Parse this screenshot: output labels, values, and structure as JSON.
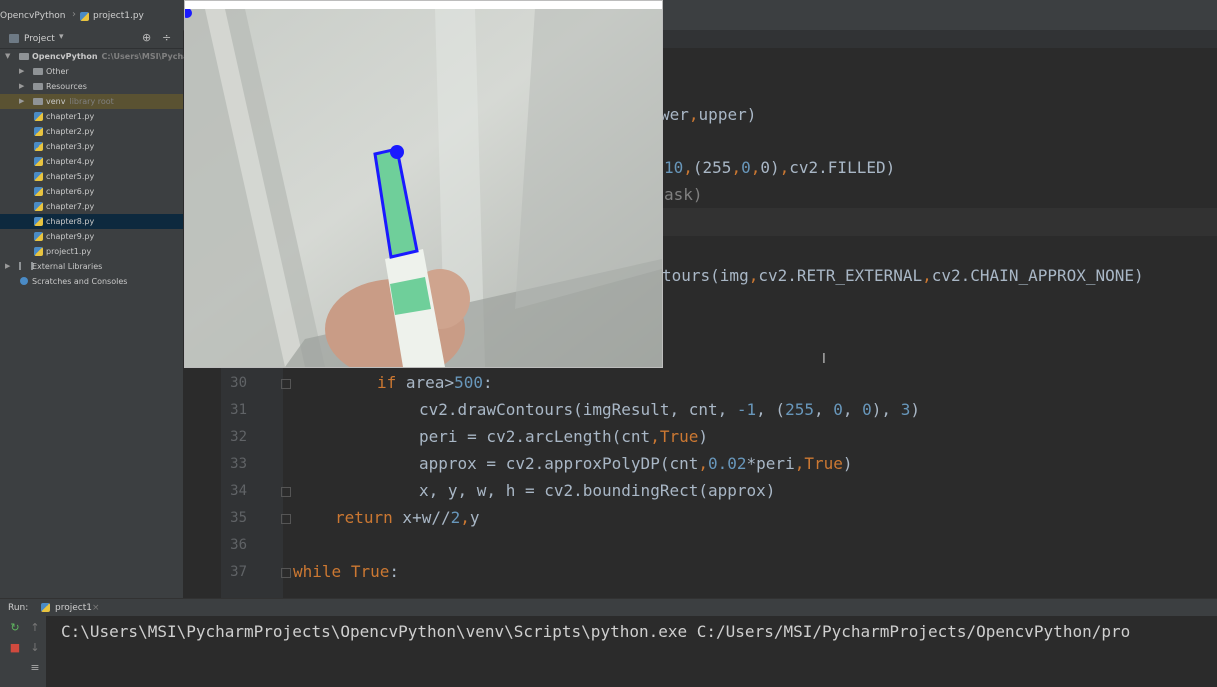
{
  "breadcrumb": {
    "project": "OpencvPython",
    "file": "project1.py"
  },
  "project_panel": {
    "title": "Project",
    "root": {
      "name": "OpencvPython",
      "path": "C:\\Users\\MSI\\Pycharm"
    },
    "items": [
      {
        "label": "Other"
      },
      {
        "label": "Resources"
      },
      {
        "label": "venv",
        "hint": "library root"
      },
      {
        "label": "chapter1.py"
      },
      {
        "label": "chapter2.py"
      },
      {
        "label": "chapter3.py"
      },
      {
        "label": "chapter4.py"
      },
      {
        "label": "chapter5.py"
      },
      {
        "label": "chapter6.py"
      },
      {
        "label": "chapter7.py"
      },
      {
        "label": "chapter8.py"
      },
      {
        "label": "chapter9.py"
      },
      {
        "label": "project1.py"
      },
      {
        "label": "External Libraries"
      },
      {
        "label": "Scratches and Consoles"
      }
    ]
  },
  "editor": {
    "partial": [
      "wer",
      "upper)",
      "10",
      "(255",
      "0",
      "0)",
      "cv2.FILLED)",
      "ask)",
      "tours(img",
      "cv2.RETR_EXTERNAL",
      "cv2.CHAIN_APPROX_NONE)"
    ],
    "lines": [
      {
        "n": "30",
        "parts": [
          [
            "if",
            "kw"
          ],
          [
            " area",
            ""
          ],
          [
            ">",
            ""
          ],
          [
            "500",
            "num"
          ],
          [
            ":",
            ""
          ]
        ]
      },
      {
        "n": "31",
        "parts": [
          [
            "cv2.drawContours(imgResult, cnt, ",
            ""
          ],
          [
            "-1",
            "num"
          ],
          [
            ", (",
            ""
          ],
          [
            "255",
            "num"
          ],
          [
            ", ",
            ""
          ],
          [
            "0",
            "num"
          ],
          [
            ", ",
            ""
          ],
          [
            "0",
            "num"
          ],
          [
            "), ",
            ""
          ],
          [
            "3",
            "num"
          ],
          [
            ")",
            ""
          ]
        ]
      },
      {
        "n": "32",
        "parts": [
          [
            "peri = cv2.arcLength(cnt",
            ""
          ],
          [
            ",",
            "kw"
          ],
          [
            "True",
            "kw"
          ],
          [
            ")",
            ""
          ]
        ]
      },
      {
        "n": "33",
        "parts": [
          [
            "approx = cv2.approxPolyDP(cnt",
            ""
          ],
          [
            ",",
            "kw"
          ],
          [
            "0.02",
            "num"
          ],
          [
            "*peri",
            ""
          ],
          [
            ",",
            "kw"
          ],
          [
            "True",
            "kw"
          ],
          [
            ")",
            ""
          ]
        ]
      },
      {
        "n": "34",
        "parts": [
          [
            "x, y, w, h = cv2.boundingRect(approx)",
            ""
          ]
        ]
      },
      {
        "n": "35",
        "parts": [
          [
            "return",
            "kw"
          ],
          [
            " x+w//",
            ""
          ],
          [
            "2",
            "num"
          ],
          [
            ",",
            "kw"
          ],
          [
            "y",
            ""
          ]
        ]
      },
      {
        "n": "36",
        "parts": []
      },
      {
        "n": "37",
        "parts": [
          [
            "while",
            "kw"
          ],
          [
            " ",
            ""
          ],
          [
            "True",
            "kw"
          ],
          [
            ":",
            ""
          ]
        ]
      }
    ]
  },
  "run": {
    "label": "Run:",
    "tab": "project1",
    "output": "C:\\Users\\MSI\\PycharmProjects\\OpencvPython\\venv\\Scripts\\python.exe C:/Users/MSI/PycharmProjects/OpencvPython/pro"
  },
  "icons": {
    "project": "folder-icon",
    "settings": "gear-icon",
    "collapse": "collapse-icon",
    "python": "python-file-icon",
    "rerun": "rerun-icon",
    "stop": "stop-icon"
  },
  "colors": {
    "accent_keyword": "#cc7832",
    "number": "#6897bb",
    "selection": "#0d293e",
    "contour": "#1a1aff",
    "marker_fill": "#6fcf9a"
  }
}
